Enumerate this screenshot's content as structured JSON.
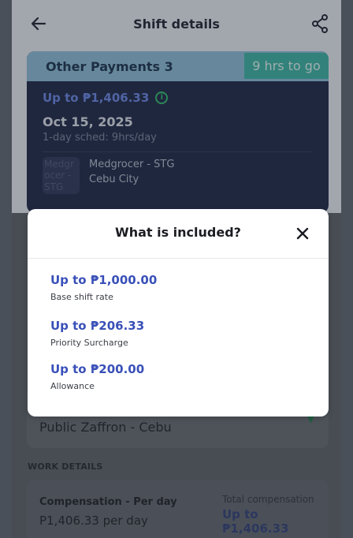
{
  "appbar": {
    "title": "Shift details"
  },
  "shift": {
    "type": "Other Payments 3",
    "countdown": "9 hrs to go",
    "amount": "Up to ₱1,406.33",
    "date": "Oct 15, 2025",
    "schedule": "1-day sched: 9hrs/day",
    "image_alt": "Medgrocer - STG",
    "location_name": "Medgrocer - STG",
    "location_city": "Cebu City"
  },
  "venue": {
    "name": "Public Zaffron - Cebu"
  },
  "work_details": {
    "section_label": "WORK DETAILS",
    "compensation_label": "Compensation - Per day",
    "compensation_value": "P1,406.33 per day",
    "total_label": "Total compensation",
    "total_value": "Up to ₱1,406.33"
  },
  "modal": {
    "title": "What is included?",
    "items": [
      {
        "amount": "Up to ₱1,000.00",
        "label": "Base shift rate"
      },
      {
        "amount": "Up to ₱206.33",
        "label": "Priority Surcharge"
      },
      {
        "amount": "Up to ₱200.00",
        "label": "Allowance"
      }
    ]
  },
  "colors": {
    "accent_blue": "#3950b8",
    "card_dark": "#1a2546",
    "countdown_teal": "#39b7a6",
    "info_green": "#2fbf6b"
  },
  "icons": [
    "back-arrow-icon",
    "share-icon",
    "info-icon",
    "close-icon",
    "chevron-down-icon"
  ]
}
